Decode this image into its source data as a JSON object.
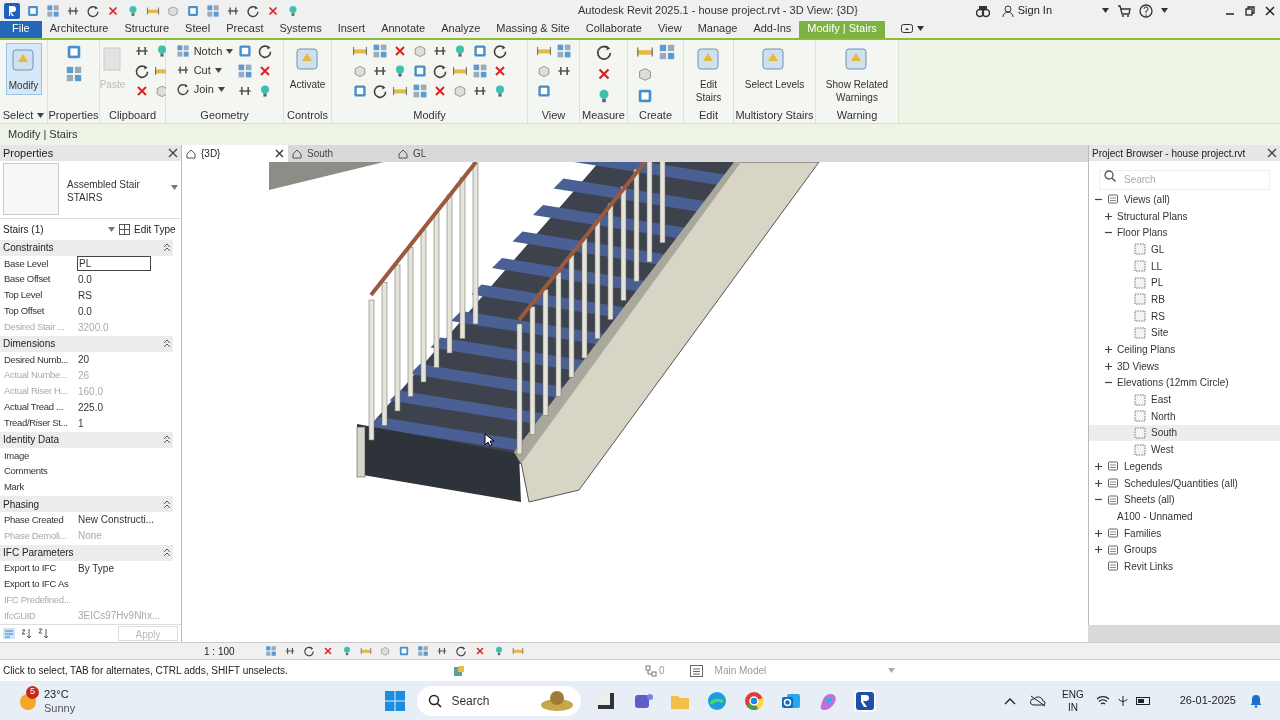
{
  "title_bar": {
    "title": "Autodesk Revit 2025.1 - house project.rvt - 3D View: {3D}",
    "sign_in": "Sign In"
  },
  "ribbon_tabs": [
    {
      "label": "File",
      "kind": "file",
      "selected": false
    },
    {
      "label": "Architecture",
      "kind": "tab",
      "selected": false
    },
    {
      "label": "Structure",
      "kind": "tab",
      "selected": false
    },
    {
      "label": "Steel",
      "kind": "tab",
      "selected": false
    },
    {
      "label": "Precast",
      "kind": "tab",
      "selected": false
    },
    {
      "label": "Systems",
      "kind": "tab",
      "selected": false
    },
    {
      "label": "Insert",
      "kind": "tab",
      "selected": false
    },
    {
      "label": "Annotate",
      "kind": "tab",
      "selected": false
    },
    {
      "label": "Analyze",
      "kind": "tab",
      "selected": false
    },
    {
      "label": "Massing & Site",
      "kind": "tab",
      "selected": false
    },
    {
      "label": "Collaborate",
      "kind": "tab",
      "selected": false
    },
    {
      "label": "View",
      "kind": "tab",
      "selected": false
    },
    {
      "label": "Manage",
      "kind": "tab",
      "selected": false
    },
    {
      "label": "Add-Ins",
      "kind": "tab",
      "selected": false
    },
    {
      "label": "Modify | Stairs",
      "kind": "contextual",
      "selected": true
    }
  ],
  "ribbon_panels": [
    {
      "title": "Select",
      "buttons": [
        {
          "kind": "large",
          "label": "Modify",
          "selected": true
        }
      ]
    },
    {
      "title": "Properties"
    },
    {
      "title": "Clipboard",
      "buttons": [
        {
          "kind": "large",
          "label": "Paste",
          "disabled": true
        }
      ]
    },
    {
      "title": "Geometry",
      "buttons": [
        {
          "kind": "small",
          "label": "Notch"
        },
        {
          "kind": "small",
          "label": "Cut"
        },
        {
          "kind": "small",
          "label": "Join"
        }
      ]
    },
    {
      "title": "Controls",
      "buttons": [
        {
          "kind": "large",
          "label": "Activate"
        }
      ]
    },
    {
      "title": "Modify"
    },
    {
      "title": "View"
    },
    {
      "title": "Measure"
    },
    {
      "title": "Create"
    },
    {
      "title": "Edit",
      "buttons": [
        {
          "kind": "large",
          "label": "Edit Stairs"
        }
      ]
    },
    {
      "title": "Multistory Stairs",
      "buttons": [
        {
          "kind": "large",
          "label": "Select Levels"
        }
      ]
    },
    {
      "title": "Warning",
      "buttons": [
        {
          "kind": "large",
          "label": "Show Related Warnings"
        }
      ]
    }
  ],
  "options_bar": "Modify | Stairs",
  "properties": {
    "title": "Properties",
    "type_name": "Assembled Stair",
    "type_family": "STAIRS",
    "filter": "Stairs (1)",
    "edit_type": "Edit Type",
    "apply": "Apply",
    "groups": [
      {
        "name": "Constraints",
        "rows": [
          {
            "label": "Base Level",
            "value": "PL",
            "kind": "field",
            "disabled": false
          },
          {
            "label": "Base Offset",
            "value": "0.0",
            "kind": "text",
            "disabled": false
          },
          {
            "label": "Top Level",
            "value": "RS",
            "kind": "text",
            "disabled": false
          },
          {
            "label": "Top Offset",
            "value": "0.0",
            "kind": "text",
            "disabled": false
          },
          {
            "label": "Desired Stair ...",
            "value": "3200.0",
            "kind": "text",
            "disabled": true
          }
        ]
      },
      {
        "name": "Dimensions",
        "rows": [
          {
            "label": "Desired Numb...",
            "value": "20",
            "kind": "text",
            "disabled": false
          },
          {
            "label": "Actual Numbe...",
            "value": "26",
            "kind": "text",
            "disabled": true
          },
          {
            "label": "Actual Riser H...",
            "value": "160.0",
            "kind": "text",
            "disabled": true
          },
          {
            "label": "Actual Tread ...",
            "value": "225.0",
            "kind": "text",
            "disabled": false
          },
          {
            "label": "Tread/Riser St...",
            "value": "1",
            "kind": "text",
            "disabled": false
          }
        ]
      },
      {
        "name": "Identity Data",
        "rows": [
          {
            "label": "Image",
            "disabled": false
          },
          {
            "label": "Comments",
            "disabled": false
          },
          {
            "label": "Mark",
            "disabled": false
          }
        ]
      },
      {
        "name": "Phasing",
        "rows": [
          {
            "label": "Phase Created",
            "value": "New Constructi...",
            "kind": "text",
            "disabled": false
          },
          {
            "label": "Phase Demoli...",
            "value": "None",
            "kind": "text",
            "disabled": true
          }
        ]
      },
      {
        "name": "IFC Parameters",
        "rows": [
          {
            "label": "Export to IFC",
            "value": "By Type",
            "kind": "text",
            "disabled": false
          },
          {
            "label": "Export to IFC As",
            "disabled": false
          },
          {
            "label": "IFC Predefined...",
            "disabled": true
          },
          {
            "label": "IfcGUID",
            "value": "3EICs97Hv9Nhx...",
            "kind": "text",
            "disabled": true
          }
        ]
      }
    ]
  },
  "view_tabs": [
    {
      "label": "{3D}",
      "selected": true
    },
    {
      "label": "South",
      "selected": false
    },
    {
      "label": "GL",
      "selected": false
    }
  ],
  "project_browser": {
    "title": "Project Browser - house project.rvt",
    "search_placeholder": "Search",
    "tree": [
      {
        "label": "Views (all)",
        "expanded": true,
        "selected": false,
        "children": [
          {
            "label": "Structural Plans",
            "expanded": false,
            "selected": false
          },
          {
            "label": "Floor Plans",
            "expanded": true,
            "selected": false,
            "children": [
              {
                "label": "GL",
                "selected": false
              },
              {
                "label": "LL",
                "selected": false
              },
              {
                "label": "PL",
                "selected": false
              },
              {
                "label": "RB",
                "selected": false
              },
              {
                "label": "RS",
                "selected": false
              },
              {
                "label": "Site",
                "selected": false
              }
            ]
          },
          {
            "label": "Ceiling Plans",
            "expanded": false,
            "selected": false
          },
          {
            "label": "3D Views",
            "expanded": false,
            "selected": false
          },
          {
            "label": "Elevations (12mm Circle)",
            "expanded": true,
            "selected": false,
            "children": [
              {
                "label": "East",
                "selected": false
              },
              {
                "label": "North",
                "selected": false
              },
              {
                "label": "South",
                "selected": true
              },
              {
                "label": "West",
                "selected": false
              }
            ]
          }
        ]
      },
      {
        "label": "Legends",
        "expanded": false,
        "selected": false
      },
      {
        "label": "Schedules/Quantities (all)",
        "expanded": false,
        "selected": false
      },
      {
        "label": "Sheets (all)",
        "expanded": true,
        "selected": false,
        "children": [
          {
            "label": "A100 - Unnamed",
            "selected": false
          }
        ]
      },
      {
        "label": "Families",
        "expanded": false,
        "selected": false
      },
      {
        "label": "Groups",
        "expanded": false,
        "selected": false
      },
      {
        "label": "Revit Links",
        "selected": false
      }
    ]
  },
  "view_control_bar": {
    "scale": "1 : 100"
  },
  "status_bar": {
    "message": "Click to select, TAB for alternates, CTRL adds, SHIFT unselects.",
    "count": "0",
    "model": "Main Model"
  },
  "taskbar": {
    "weather": {
      "temperature": "23°C",
      "condition": "Sunny",
      "badge": "5"
    },
    "search_placeholder": "Search",
    "language": "ENG",
    "region": "IN",
    "date": "26-01-2025"
  }
}
